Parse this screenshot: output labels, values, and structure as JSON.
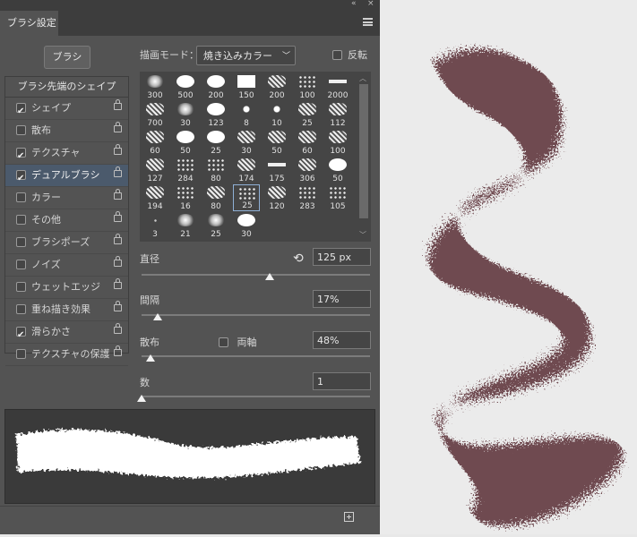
{
  "tab": {
    "title": "ブラシ設定"
  },
  "brushes_button": "ブラシ",
  "draw_mode": {
    "label": "描画モード：",
    "value": "焼き込みカラー"
  },
  "flip": {
    "label": "反転",
    "checked": false
  },
  "left_list": {
    "header": "ブラシ先端のシェイプ",
    "items": [
      {
        "label": "シェイプ",
        "checked": true
      },
      {
        "label": "散布",
        "checked": false
      },
      {
        "label": "テクスチャ",
        "checked": true
      },
      {
        "label": "デュアルブラシ",
        "checked": true,
        "selected": true
      },
      {
        "label": "カラー",
        "checked": false
      },
      {
        "label": "その他",
        "checked": false
      },
      {
        "label": "ブラシポーズ",
        "checked": false
      },
      {
        "label": "ノイズ",
        "checked": false
      },
      {
        "label": "ウェットエッジ",
        "checked": false
      },
      {
        "label": "重ね描き効果",
        "checked": false
      },
      {
        "label": "滑らかさ",
        "checked": true
      },
      {
        "label": "テクスチャの保護",
        "checked": false
      }
    ]
  },
  "brush_grid": {
    "selected": "25",
    "brushes": [
      {
        "size": "300",
        "icon": "soft"
      },
      {
        "size": "500",
        "icon": "hard"
      },
      {
        "size": "200",
        "icon": "hard"
      },
      {
        "size": "150",
        "icon": "sq"
      },
      {
        "size": "200",
        "icon": "tex"
      },
      {
        "size": "100",
        "icon": "dots"
      },
      {
        "size": "2000",
        "icon": "stroke"
      },
      {
        "size": "700",
        "icon": "tex"
      },
      {
        "size": "30",
        "icon": "soft"
      },
      {
        "size": "123",
        "icon": "hard"
      },
      {
        "size": "8",
        "icon": "splat"
      },
      {
        "size": "10",
        "icon": "splat"
      },
      {
        "size": "25",
        "icon": "tex"
      },
      {
        "size": "112",
        "icon": "tex"
      },
      {
        "size": "60",
        "icon": "tex"
      },
      {
        "size": "50",
        "icon": "hard"
      },
      {
        "size": "25",
        "icon": "hard"
      },
      {
        "size": "30",
        "icon": "tex"
      },
      {
        "size": "50",
        "icon": "tex"
      },
      {
        "size": "60",
        "icon": "tex"
      },
      {
        "size": "100",
        "icon": "tex"
      },
      {
        "size": "127",
        "icon": "tex"
      },
      {
        "size": "284",
        "icon": "dots"
      },
      {
        "size": "80",
        "icon": "dots"
      },
      {
        "size": "174",
        "icon": "tex"
      },
      {
        "size": "175",
        "icon": "stroke"
      },
      {
        "size": "306",
        "icon": "tex"
      },
      {
        "size": "50",
        "icon": "hard"
      },
      {
        "size": "194",
        "icon": "tex"
      },
      {
        "size": "16",
        "icon": "dots"
      },
      {
        "size": "80",
        "icon": "tex"
      },
      {
        "size": "25",
        "icon": "dots"
      },
      {
        "size": "120",
        "icon": "tex"
      },
      {
        "size": "283",
        "icon": "dots"
      },
      {
        "size": "105",
        "icon": "dots"
      },
      {
        "size": "3",
        "icon": "speck"
      },
      {
        "size": "21",
        "icon": "soft"
      },
      {
        "size": "25",
        "icon": "soft"
      },
      {
        "size": "30",
        "icon": "hard"
      }
    ]
  },
  "params": {
    "diameter": {
      "label": "直径",
      "value": "125 px",
      "level": 0.56
    },
    "spacing": {
      "label": "間隔",
      "value": "17%",
      "level": 0.07
    },
    "scatter": {
      "label": "散布",
      "both_axes_label": "両軸",
      "both_axes_checked": false,
      "value": "48%",
      "level": 0.04
    },
    "count": {
      "label": "数",
      "value": "1",
      "level": 0.0
    }
  },
  "colors": {
    "panel": "#535353",
    "stroke": "#5a2e34",
    "preview_stroke": "#ffffff",
    "selection": "#4b5a6c"
  }
}
